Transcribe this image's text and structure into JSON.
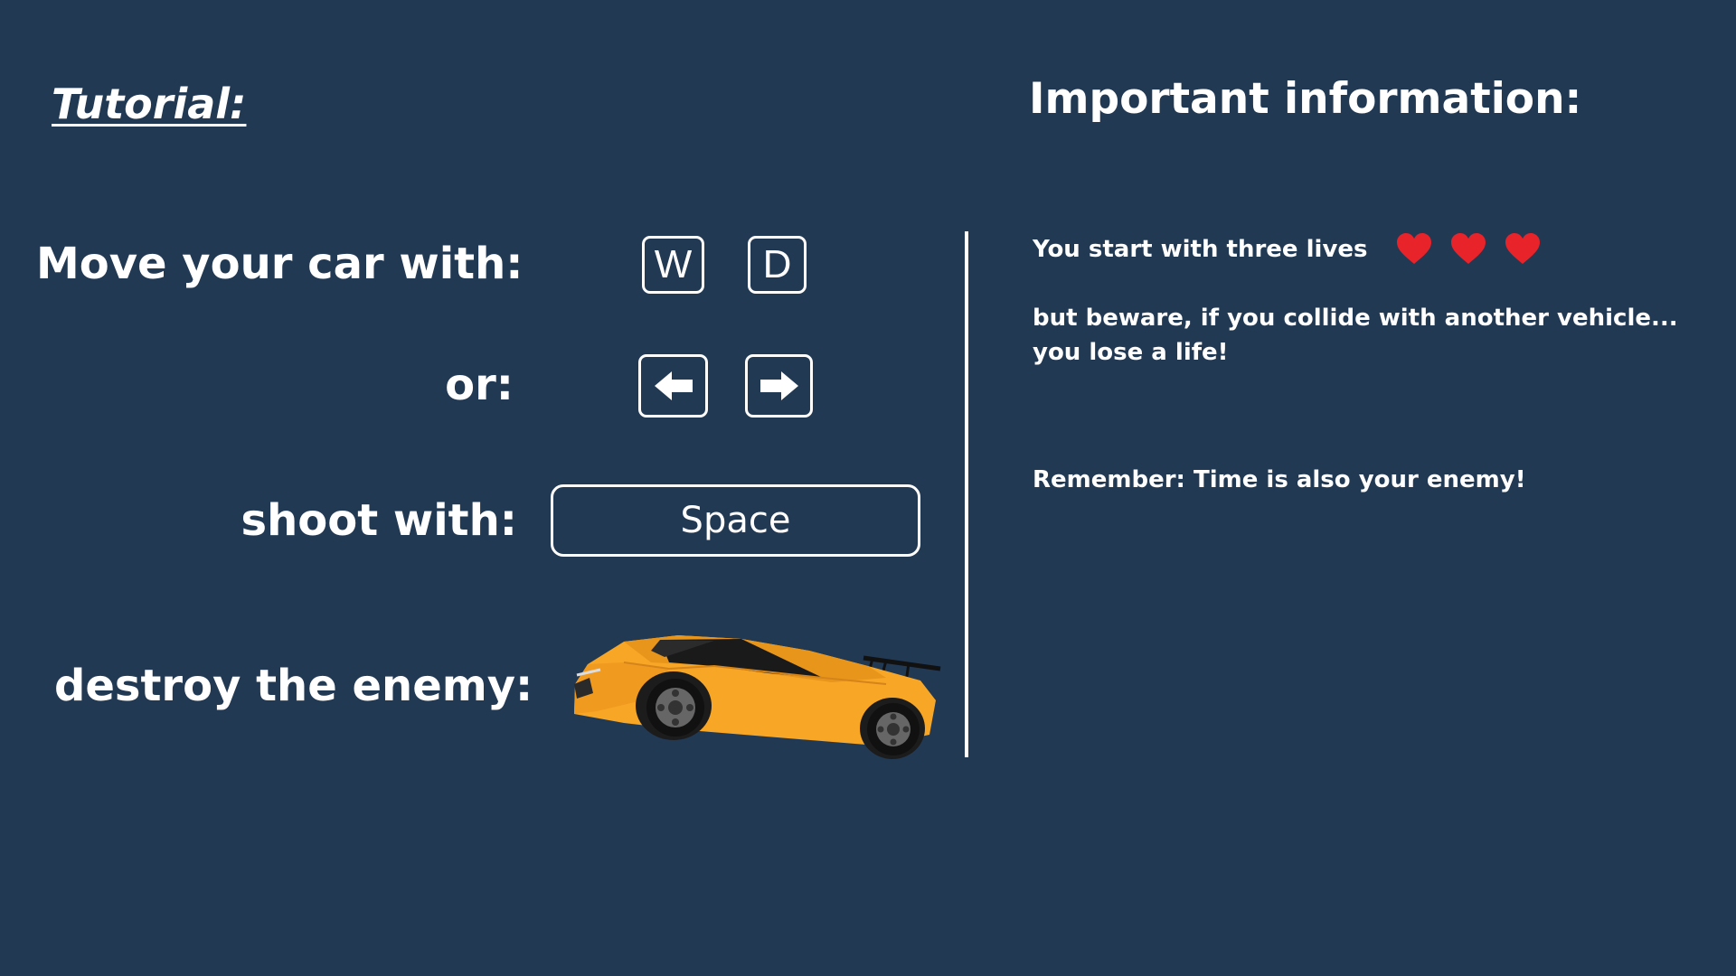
{
  "tutorial": {
    "title": "Tutorial:",
    "move_label": "Move your car with:",
    "or_label": "or:",
    "shoot_label": "shoot with:",
    "destroy_label": "destroy the enemy:",
    "keys": {
      "w": "W",
      "d": "D",
      "left_arrow_icon": "arrow-left-icon",
      "right_arrow_icon": "arrow-right-icon",
      "space": "Space"
    },
    "enemy_icon": "car-icon"
  },
  "info": {
    "title": "Important information:",
    "lives_text": "You start with three lives",
    "lives_count": 3,
    "life_icon": "heart-icon",
    "beware_line1": "but beware, if you collide with another vehicle...",
    "beware_line2": "you lose a life!",
    "remember_text": "Remember: Time is also your enemy!"
  },
  "colors": {
    "background": "#223954",
    "text": "#ffffff",
    "heart": "#e8232a",
    "car_body": "#f5a623"
  }
}
